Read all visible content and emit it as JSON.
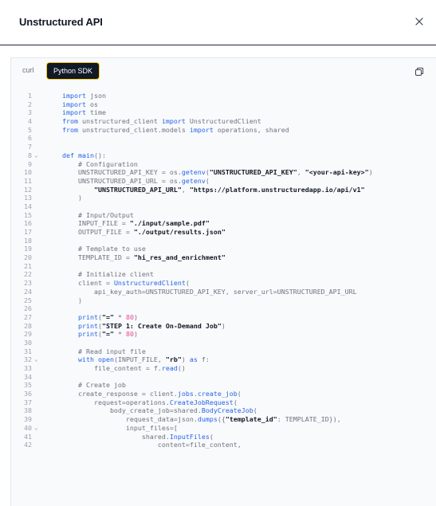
{
  "dialog": {
    "title": "Unstructured API"
  },
  "tabs": [
    {
      "label": "curl",
      "active": false
    },
    {
      "label": "Python SDK",
      "active": true
    }
  ],
  "icons": {
    "close": "close-icon",
    "copy": "copy-icon",
    "fold": "chevron-down-icon"
  },
  "colors": {
    "keyword": "#2563eb",
    "comment": "#6b7280",
    "active_tab_bg": "#111827",
    "active_tab_border": "#facc15"
  },
  "code": {
    "language": "python",
    "lines": [
      {
        "n": "1",
        "fold": false,
        "parts": [
          [
            "kw",
            "import"
          ],
          [
            "tx",
            " json"
          ]
        ]
      },
      {
        "n": "2",
        "fold": false,
        "parts": [
          [
            "kw",
            "import"
          ],
          [
            "tx",
            " os"
          ]
        ]
      },
      {
        "n": "3",
        "fold": false,
        "parts": [
          [
            "kw",
            "import"
          ],
          [
            "tx",
            " time"
          ]
        ]
      },
      {
        "n": "4",
        "fold": false,
        "parts": [
          [
            "kw",
            "from"
          ],
          [
            "tx",
            " unstructured_client "
          ],
          [
            "kw",
            "import"
          ],
          [
            "tx",
            " UnstructuredClient"
          ]
        ]
      },
      {
        "n": "5",
        "fold": false,
        "parts": [
          [
            "kw",
            "from"
          ],
          [
            "tx",
            " unstructured_client.models "
          ],
          [
            "kw",
            "import"
          ],
          [
            "tx",
            " operations, shared"
          ]
        ]
      },
      {
        "n": "6",
        "fold": false,
        "parts": []
      },
      {
        "n": "7",
        "fold": false,
        "parts": []
      },
      {
        "n": "8",
        "fold": true,
        "parts": [
          [
            "kw",
            "def"
          ],
          [
            "tx",
            " "
          ],
          [
            "fn",
            "main"
          ],
          [
            "tx",
            "():"
          ]
        ]
      },
      {
        "n": "9",
        "fold": false,
        "parts": [
          [
            "cm",
            "    # Configuration"
          ]
        ]
      },
      {
        "n": "10",
        "fold": false,
        "parts": [
          [
            "tx",
            "    UNSTRUCTURED_API_KEY = os."
          ],
          [
            "fn",
            "getenv"
          ],
          [
            "tx",
            "("
          ],
          [
            "st",
            "\"UNSTRUCTURED_API_KEY\""
          ],
          [
            "tx",
            ", "
          ],
          [
            "st",
            "\"<your-api-key>\""
          ],
          [
            "tx",
            ")"
          ]
        ]
      },
      {
        "n": "11",
        "fold": false,
        "parts": [
          [
            "tx",
            "    UNSTRUCTURED_API_URL = os."
          ],
          [
            "fn",
            "getenv"
          ],
          [
            "tx",
            "("
          ]
        ]
      },
      {
        "n": "12",
        "fold": false,
        "parts": [
          [
            "st",
            "        \"UNSTRUCTURED_API_URL\""
          ],
          [
            "tx",
            ", "
          ],
          [
            "st",
            "\"https://platform.unstructuredapp.io/api/v1\""
          ]
        ]
      },
      {
        "n": "13",
        "fold": false,
        "parts": [
          [
            "tx",
            "    )"
          ]
        ]
      },
      {
        "n": "14",
        "fold": false,
        "parts": []
      },
      {
        "n": "15",
        "fold": false,
        "parts": [
          [
            "cm",
            "    # Input/Output"
          ]
        ]
      },
      {
        "n": "16",
        "fold": false,
        "parts": [
          [
            "tx",
            "    INPUT_FILE = "
          ],
          [
            "st",
            "\"./input/sample.pdf\""
          ]
        ]
      },
      {
        "n": "17",
        "fold": false,
        "parts": [
          [
            "tx",
            "    OUTPUT_FILE = "
          ],
          [
            "st",
            "\"./output/results.json\""
          ]
        ]
      },
      {
        "n": "18",
        "fold": false,
        "parts": []
      },
      {
        "n": "19",
        "fold": false,
        "parts": [
          [
            "cm",
            "    # Template to use"
          ]
        ]
      },
      {
        "n": "20",
        "fold": false,
        "parts": [
          [
            "tx",
            "    TEMPLATE_ID = "
          ],
          [
            "st",
            "\"hi_res_and_enrichment\""
          ]
        ]
      },
      {
        "n": "21",
        "fold": false,
        "parts": []
      },
      {
        "n": "22",
        "fold": false,
        "parts": [
          [
            "cm",
            "    # Initialize client"
          ]
        ]
      },
      {
        "n": "23",
        "fold": false,
        "parts": [
          [
            "tx",
            "    client = "
          ],
          [
            "fn",
            "UnstructuredClient"
          ],
          [
            "tx",
            "("
          ]
        ]
      },
      {
        "n": "24",
        "fold": false,
        "parts": [
          [
            "tx",
            "        api_key_auth=UNSTRUCTURED_API_KEY, server_url=UNSTRUCTURED_API_URL"
          ]
        ]
      },
      {
        "n": "25",
        "fold": false,
        "parts": [
          [
            "tx",
            "    )"
          ]
        ]
      },
      {
        "n": "26",
        "fold": false,
        "parts": []
      },
      {
        "n": "27",
        "fold": false,
        "parts": [
          [
            "tx",
            "    "
          ],
          [
            "fn",
            "print"
          ],
          [
            "tx",
            "("
          ],
          [
            "st",
            "\"=\""
          ],
          [
            "tx",
            " * "
          ],
          [
            "nm",
            "80"
          ],
          [
            "tx",
            ")"
          ]
        ]
      },
      {
        "n": "28",
        "fold": false,
        "parts": [
          [
            "tx",
            "    "
          ],
          [
            "fn",
            "print"
          ],
          [
            "tx",
            "("
          ],
          [
            "st",
            "\"STEP 1: Create On-Demand Job\""
          ],
          [
            "tx",
            ")"
          ]
        ]
      },
      {
        "n": "29",
        "fold": false,
        "parts": [
          [
            "tx",
            "    "
          ],
          [
            "fn",
            "print"
          ],
          [
            "tx",
            "("
          ],
          [
            "st",
            "\"=\""
          ],
          [
            "tx",
            " * "
          ],
          [
            "nm",
            "80"
          ],
          [
            "tx",
            ")"
          ]
        ]
      },
      {
        "n": "30",
        "fold": false,
        "parts": []
      },
      {
        "n": "31",
        "fold": false,
        "parts": [
          [
            "cm",
            "    # Read input file"
          ]
        ]
      },
      {
        "n": "32",
        "fold": true,
        "parts": [
          [
            "tx",
            "    "
          ],
          [
            "kw",
            "with"
          ],
          [
            "tx",
            " "
          ],
          [
            "fn",
            "open"
          ],
          [
            "tx",
            "(INPUT_FILE, "
          ],
          [
            "st",
            "\"rb\""
          ],
          [
            "tx",
            ") "
          ],
          [
            "kw",
            "as"
          ],
          [
            "tx",
            " f:"
          ]
        ]
      },
      {
        "n": "33",
        "fold": false,
        "parts": [
          [
            "tx",
            "        file_content = f."
          ],
          [
            "fn",
            "read"
          ],
          [
            "tx",
            "()"
          ]
        ]
      },
      {
        "n": "34",
        "fold": false,
        "parts": []
      },
      {
        "n": "35",
        "fold": false,
        "parts": [
          [
            "cm",
            "    # Create job"
          ]
        ]
      },
      {
        "n": "36",
        "fold": false,
        "parts": [
          [
            "tx",
            "    create_response = client."
          ],
          [
            "fn",
            "jobs"
          ],
          [
            "tx",
            "."
          ],
          [
            "fn",
            "create_job"
          ],
          [
            "tx",
            "("
          ]
        ]
      },
      {
        "n": "37",
        "fold": false,
        "parts": [
          [
            "tx",
            "        request=operations."
          ],
          [
            "fn",
            "CreateJobRequest"
          ],
          [
            "tx",
            "("
          ]
        ]
      },
      {
        "n": "38",
        "fold": false,
        "parts": [
          [
            "tx",
            "            body_create_job=shared."
          ],
          [
            "fn",
            "BodyCreateJob"
          ],
          [
            "tx",
            "("
          ]
        ]
      },
      {
        "n": "39",
        "fold": false,
        "parts": [
          [
            "tx",
            "                request_data=json."
          ],
          [
            "fn",
            "dumps"
          ],
          [
            "tx",
            "({"
          ],
          [
            "st",
            "\"template_id\""
          ],
          [
            "tx",
            ": TEMPLATE_ID}),"
          ]
        ]
      },
      {
        "n": "40",
        "fold": true,
        "parts": [
          [
            "tx",
            "                input_files=["
          ]
        ]
      },
      {
        "n": "41",
        "fold": false,
        "parts": [
          [
            "tx",
            "                    shared."
          ],
          [
            "fn",
            "InputFiles"
          ],
          [
            "tx",
            "("
          ]
        ]
      },
      {
        "n": "42",
        "fold": false,
        "parts": [
          [
            "tx",
            "                        content=file_content,"
          ]
        ]
      }
    ]
  }
}
